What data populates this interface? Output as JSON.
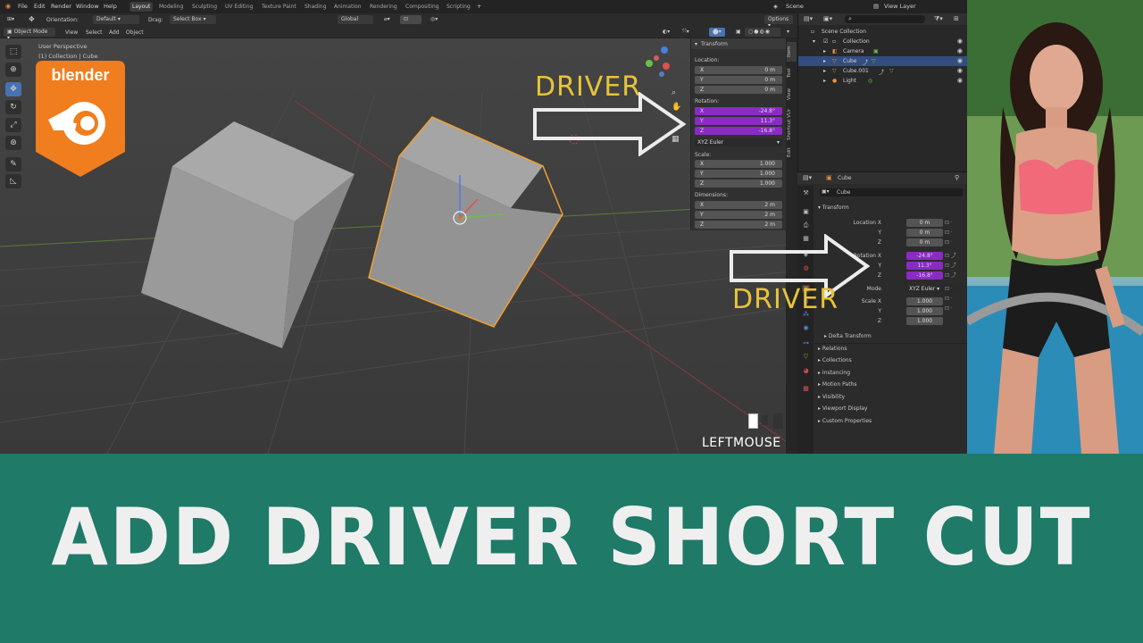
{
  "menubar": {
    "items": [
      "File",
      "Edit",
      "Render",
      "Window",
      "Help"
    ],
    "workspaces": [
      "Layout",
      "Modeling",
      "Sculpting",
      "UV Editing",
      "Texture Paint",
      "Shading",
      "Animation",
      "Rendering",
      "Compositing",
      "Scripting"
    ],
    "active_workspace": "Layout",
    "scene": "Scene",
    "view_layer": "View Layer"
  },
  "toolbar": {
    "orientation_label": "Orientation:",
    "orientation_value": "Default",
    "drag_label": "Drag:",
    "drag_value": "Select Box",
    "transform_space": "Global",
    "options": "Options",
    "mode": "Object Mode",
    "menus": [
      "View",
      "Select",
      "Add",
      "Object"
    ]
  },
  "viewport": {
    "perspective": "User Perspective",
    "collection_path": "(1) Collection | Cube"
  },
  "npanel": {
    "header": "Transform",
    "location_label": "Location:",
    "location": [
      {
        "k": "X",
        "v": "0 m"
      },
      {
        "k": "Y",
        "v": "0 m"
      },
      {
        "k": "Z",
        "v": "0 m"
      }
    ],
    "rotation_label": "Rotation:",
    "rotation": [
      {
        "k": "X",
        "v": "-24.8°"
      },
      {
        "k": "Y",
        "v": "11.3°"
      },
      {
        "k": "Z",
        "v": "-16.8°"
      }
    ],
    "rotation_mode": "XYZ Euler",
    "scale_label": "Scale:",
    "scale": [
      {
        "k": "X",
        "v": "1.000"
      },
      {
        "k": "Y",
        "v": "1.000"
      },
      {
        "k": "Z",
        "v": "1.000"
      }
    ],
    "dimensions_label": "Dimensions:",
    "dimensions": [
      {
        "k": "X",
        "v": "2 m"
      },
      {
        "k": "Y",
        "v": "2 m"
      },
      {
        "k": "Z",
        "v": "2 m"
      }
    ],
    "tabs": [
      "Item",
      "Tool",
      "View",
      "Shortcut VUr",
      "Edit"
    ]
  },
  "outliner": {
    "rows": [
      "Scene Collection",
      "Collection",
      "Camera",
      "Cube",
      "Cube.001",
      "Light"
    ]
  },
  "properties": {
    "object_name": "Cube",
    "object_field": "Cube",
    "section": "Transform",
    "location_labels": [
      "Location X",
      "Y",
      "Z"
    ],
    "location_values": [
      "0 m",
      "0 m",
      "0 m"
    ],
    "rotation_labels": [
      "Rotation X",
      "Y",
      "Z"
    ],
    "rotation_values": [
      "-24.8°",
      "11.3°",
      "-16.8°"
    ],
    "mode_label": "Mode",
    "mode_value": "XYZ Euler",
    "scale_labels": [
      "Scale X",
      "Y",
      "Z"
    ],
    "scale_values": [
      "1.000",
      "1.000",
      "1.000"
    ],
    "subsections": [
      "Delta Transform",
      "Relations",
      "Collections",
      "Instancing",
      "Motion Paths",
      "Visibility",
      "Viewport Display",
      "Custom Properties"
    ]
  },
  "overlay": {
    "driver_top": "DRIVER",
    "driver_bottom": "DRIVER",
    "leftmouse": "LEFTMOUSE",
    "logo_text": "blender"
  },
  "banner": {
    "title": "ADD DRIVER SHORT CUT"
  },
  "colors": {
    "purple_field": "#8a2bc4",
    "driver_text": "#e8c33a",
    "banner_bg": "#1f7a68",
    "selection": "#334d80",
    "logo_orange": "#f07d1e"
  }
}
